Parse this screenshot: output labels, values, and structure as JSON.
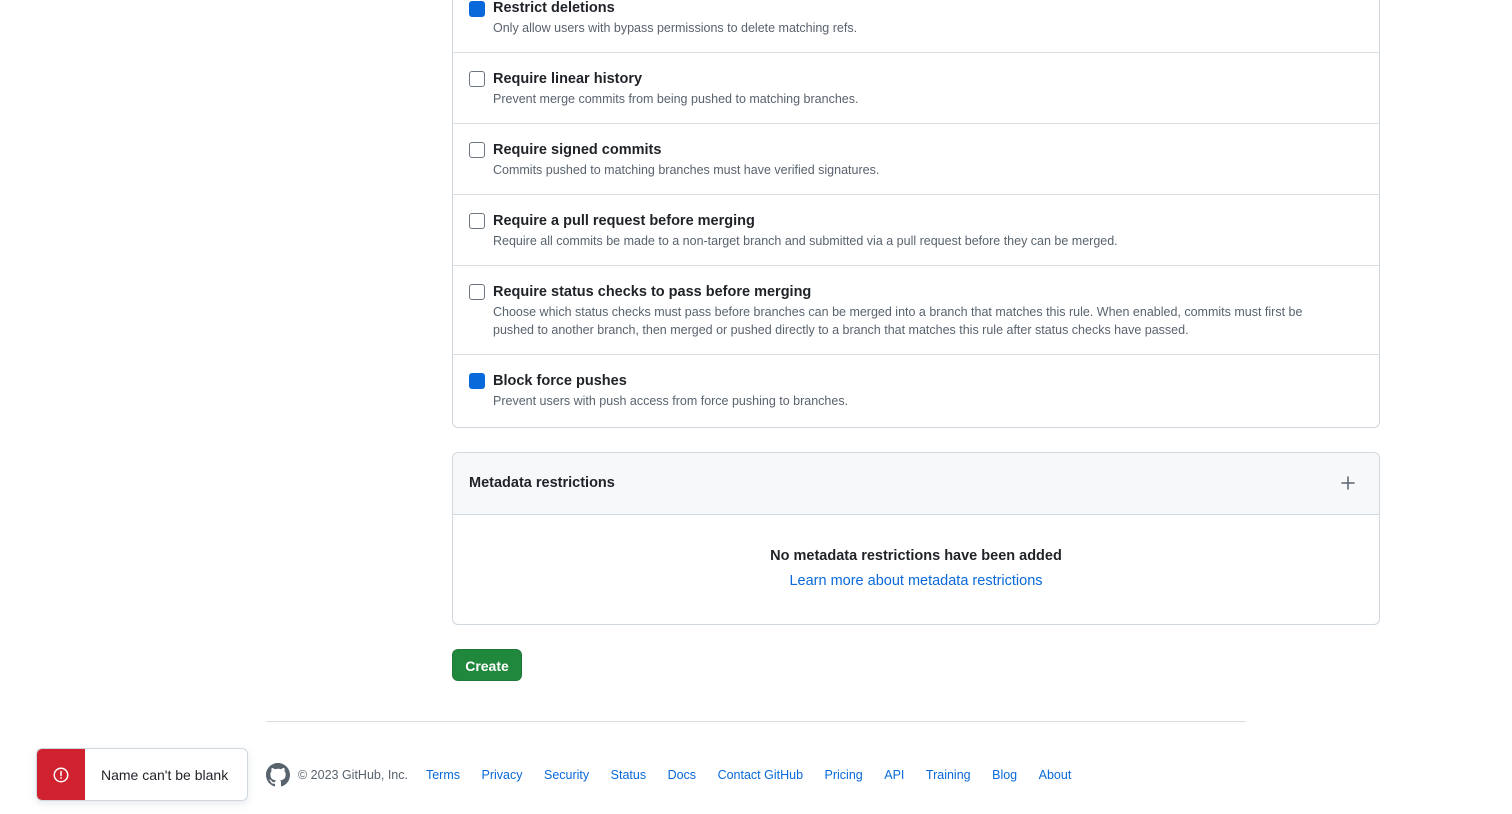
{
  "rules": [
    {
      "title": "Restrict deletions",
      "description": "Only allow users with bypass permissions to delete matching refs.",
      "checked": true
    },
    {
      "title": "Require linear history",
      "description": "Prevent merge commits from being pushed to matching branches.",
      "checked": false
    },
    {
      "title": "Require signed commits",
      "description": "Commits pushed to matching branches must have verified signatures.",
      "checked": false
    },
    {
      "title": "Require a pull request before merging",
      "description": "Require all commits be made to a non-target branch and submitted via a pull request before they can be merged.",
      "checked": false
    },
    {
      "title": "Require status checks to pass before merging",
      "description": "Choose which status checks must pass before branches can be merged into a branch that matches this rule. When enabled, commits must first be pushed to another branch, then merged or pushed directly to a branch that matches this rule after status checks have passed.",
      "checked": false
    },
    {
      "title": "Block force pushes",
      "description": "Prevent users with push access from force pushing to branches.",
      "checked": true
    }
  ],
  "metadata": {
    "title": "Metadata restrictions",
    "empty_text": "No metadata restrictions have been added",
    "learn_more": "Learn more about metadata restrictions",
    "add_icon": "plus-icon"
  },
  "create_label": "Create",
  "footer": {
    "copyright": "© 2023 GitHub, Inc.",
    "logo_icon": "github-mark-icon",
    "links": [
      "Terms",
      "Privacy",
      "Security",
      "Status",
      "Docs",
      "Contact GitHub",
      "Pricing",
      "API",
      "Training",
      "Blog",
      "About"
    ]
  },
  "toast": {
    "message": "Name can't be blank",
    "icon": "alert-circle-icon"
  },
  "colors": {
    "accent": "#0969da",
    "create_button": "#1f883d",
    "error": "#cf222e"
  }
}
